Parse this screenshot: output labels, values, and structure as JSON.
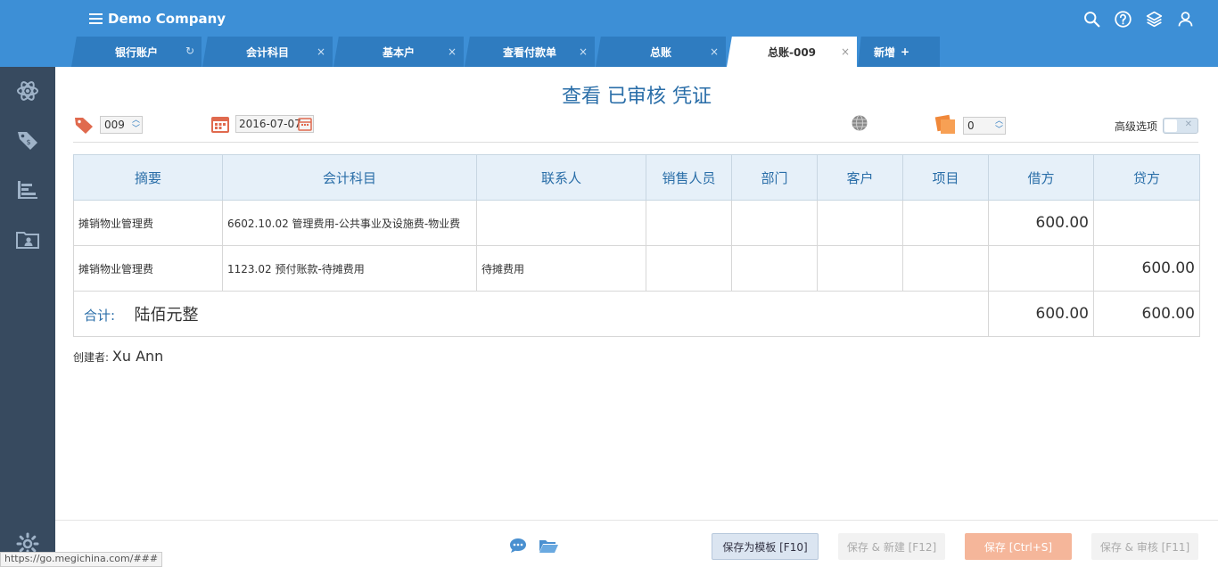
{
  "header": {
    "company": "Demo Company",
    "icons": [
      "search-icon",
      "help-icon",
      "layers-icon",
      "user-icon"
    ]
  },
  "tabs": [
    {
      "label": "银行账户",
      "action": "refresh"
    },
    {
      "label": "会计科目",
      "action": "close"
    },
    {
      "label": "基本户",
      "action": "close"
    },
    {
      "label": "查看付款单",
      "action": "close"
    },
    {
      "label": "总账",
      "action": "close"
    },
    {
      "label": "总账-009",
      "action": "close",
      "active": true
    }
  ],
  "new_tab": {
    "label": "新增",
    "plus": "+"
  },
  "tab_close_glyph": "×",
  "tab_refresh_glyph": "↻",
  "sidebar": [
    "atom-icon",
    "tags-icon",
    "chart-bars-icon",
    "folder-user-icon",
    "gear-icon"
  ],
  "page": {
    "title": "查看 已审核 凭证"
  },
  "voucher": {
    "number": "009",
    "date": "2016-07-07",
    "attachments": "0",
    "advanced_label": "高级选项"
  },
  "table": {
    "headers": [
      "摘要",
      "会计科目",
      "联系人",
      "销售人员",
      "部门",
      "客户",
      "项目",
      "借方",
      "贷方"
    ],
    "rows": [
      [
        "摊销物业管理费",
        "6602.10.02 管理费用-公共事业及设施费-物业费",
        "",
        "",
        "",
        "",
        "",
        "600.00",
        ""
      ],
      [
        "摊销物业管理费",
        "1123.02 预付账款-待摊费用",
        "待摊费用",
        "",
        "",
        "",
        "",
        "",
        "600.00"
      ]
    ],
    "total": {
      "label": "合计:",
      "words": "陆佰元整",
      "debit": "600.00",
      "credit": "600.00"
    }
  },
  "creator": {
    "label": "创建者:",
    "name": "Xu Ann"
  },
  "footer": {
    "template_btn": "保存为模板 [F10]",
    "save_new_btn": "保存 & 新建 [F12]",
    "save_btn": "保存 [Ctrl+S]",
    "save_audit_btn": "保存 & 审核 [F11]"
  },
  "status_url": "https://go.megichina.com/###",
  "colors": {
    "header": "#3d8fd6",
    "tab": "#2f7cc0",
    "sidebar": "#374a5f",
    "accent": "#2a6ea8",
    "save": "#f5b69a"
  }
}
